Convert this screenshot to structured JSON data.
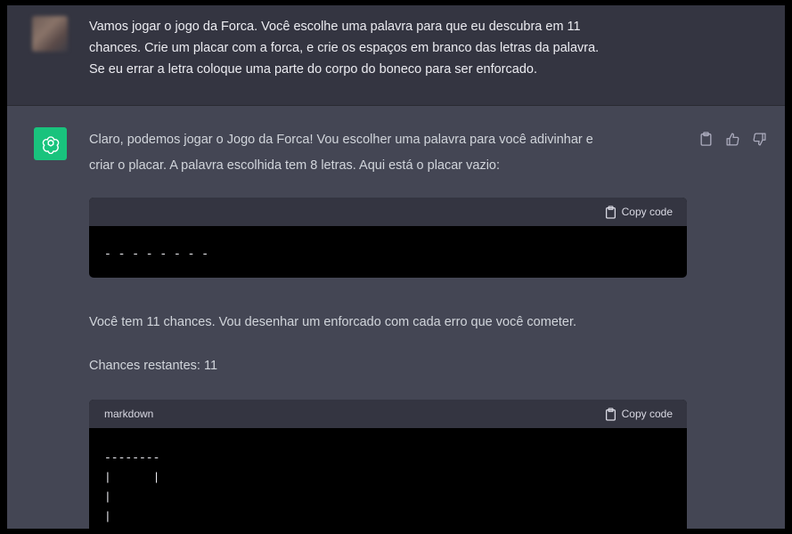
{
  "user_message": {
    "line1": "Vamos jogar o jogo da Forca. Você escolhe uma palavra para que eu descubra em 11",
    "line2": "chances.  Crie um placar com a forca,  e crie os espaços em branco das letras da palavra.",
    "line3": "Se eu errar a letra coloque uma parte do corpo do boneco para ser enforcado."
  },
  "assistant_message": {
    "intro_line1": "Claro, podemos jogar o Jogo da Forca! Vou escolher uma palavra para você adivinhar e",
    "intro_line2": "criar o placar. A palavra escolhida tem 8 letras. Aqui está o placar vazio:",
    "code_block_1": {
      "language": "",
      "copy_label": "Copy code",
      "content": "- - - - - - - -"
    },
    "chances_text": "Você tem 11 chances. Vou desenhar um enforcado com cada erro que você cometer.",
    "remaining_text": "Chances restantes: 11",
    "code_block_2": {
      "language": "markdown",
      "copy_label": "Copy code",
      "content": "--------\n|      |\n|\n|"
    }
  },
  "icons": {
    "copy": "clipboard-icon",
    "thumbs_up": "thumbs-up-icon",
    "thumbs_down": "thumbs-down-icon",
    "assistant_logo": "openai-logo-icon"
  },
  "colors": {
    "user_bg": "#343541",
    "assistant_bg": "#444654",
    "assistant_avatar": "#19c37d",
    "code_bg": "#000000"
  }
}
